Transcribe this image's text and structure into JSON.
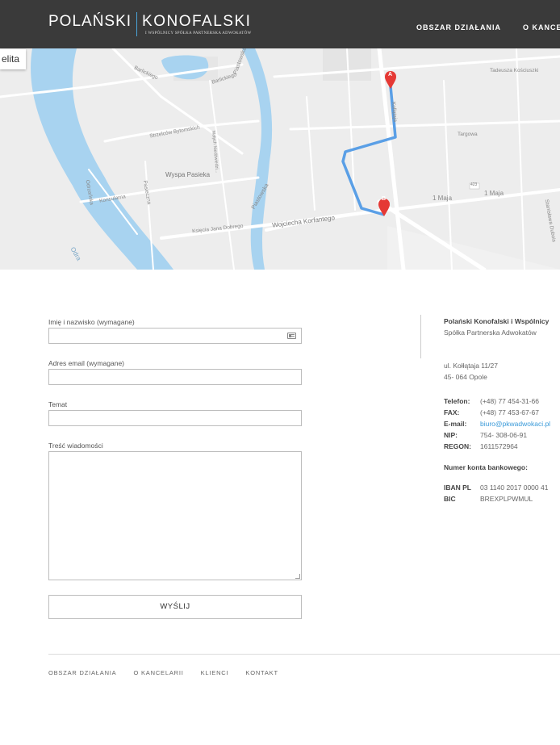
{
  "header": {
    "logo_left": "POLAŃSKI",
    "logo_right": "KONOFALSKI",
    "logo_sub": "I WSPÓLNICY SPÓŁKA PARTNERSKA ADWOKATÓW",
    "nav": [
      "OBSZAR DZIAŁANIA",
      "O KANCEL"
    ]
  },
  "map": {
    "button_label": "elita",
    "marker_a": "A",
    "marker_b": "B",
    "streets": {
      "bolkowska": "Barlickiego",
      "barlickiego": "Barlickiego",
      "strzelcow": "Strzelców Bytomskich",
      "wyspa": "Wyspa Pasieka",
      "konsularna": "Konsularna",
      "piastowska": "Piastowska",
      "ozimska": "Odrzańska",
      "pasiecznik": "Pasieczna",
      "kosciuszki": "Tadeusza Kościuszki",
      "targowa": "Targowa",
      "maja1": "1 Maja",
      "maja2": "1 Maja",
      "korfantego": "Wojciecha Korfantego",
      "dobrego": "Księcia Jana Dobrego",
      "odra": "Odra",
      "road_num": "423",
      "stanislawa": "Stanisława Dubois",
      "kollataja": "Kollątaja",
      "matysiaka": "Małych Niedźwiedzi...",
      "piastowska_top": "Piastowska"
    }
  },
  "form": {
    "name_label": "Imię i nazwisko (wymagane)",
    "email_label": "Adres email (wymagane)",
    "subject_label": "Temat",
    "message_label": "Treść wiadomości",
    "submit_label": "WYŚLIJ"
  },
  "contact": {
    "company": "Polański Konofalski i Wspólnicy",
    "company_sub": "Spółka Partnerska Adwokatów",
    "address1": "ul. Kołłątaja 11/27",
    "address2": "45- 064 Opole",
    "rows": [
      {
        "k": "Telefon:",
        "v": "(+48) 77 454-31-66"
      },
      {
        "k": "FAX:",
        "v": "(+48) 77 453-67-67"
      },
      {
        "k": "E-mail:",
        "v": "biuro@pkwadwokaci.pl"
      },
      {
        "k": "NIP:",
        "v": "754- 308-06-91"
      },
      {
        "k": "REGON:",
        "v": "1611572964"
      }
    ],
    "bank_heading": "Numer konta bankowego:",
    "iban_k": "IBAN PL",
    "iban_v": "03 1140 2017 0000 41",
    "bic_k": "BIC",
    "bic_v": "BREXPLPWMUL"
  },
  "footer": {
    "nav": [
      "OBSZAR DZIAŁANIA",
      "O KANCELARII",
      "KLIENCI",
      "KONTAKT"
    ]
  },
  "colors": {
    "header_bg": "#3a3a3a",
    "accent": "#4aa3d8",
    "route": "#5a9fe6",
    "marker": "#e53935",
    "river": "#a8d3f0"
  }
}
